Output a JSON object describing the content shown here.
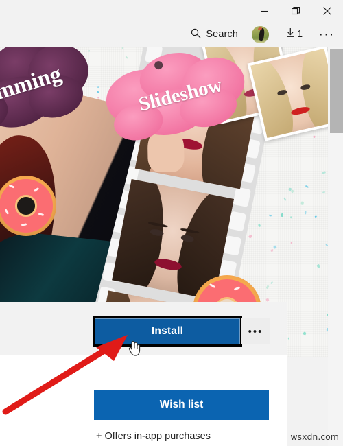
{
  "window": {
    "controls": [
      {
        "name": "minimize",
        "glyph": "minimize-icon"
      },
      {
        "name": "restore",
        "glyph": "restore-icon"
      },
      {
        "name": "close",
        "glyph": "close-icon"
      }
    ]
  },
  "commandbar": {
    "search_label": "Search",
    "search_icon": "search-icon",
    "avatar": "account-avatar",
    "downloads_icon": "downloads-arrow-icon",
    "downloads_count": "1",
    "more_label": "···"
  },
  "hero": {
    "badges": [
      {
        "text": "imming",
        "full_text": "Slimming",
        "color": "#5d2a4e"
      },
      {
        "text": "Slideshow",
        "color": "#f57fa8"
      }
    ]
  },
  "actions": {
    "install_label": "Install",
    "more_options_label": "•••",
    "wishlist_label": "Wish list",
    "iap_note": "+ Offers in-app purchases"
  },
  "overlay": {
    "cursor": "hand-pointer-cursor",
    "arrow": "red-annotation-arrow",
    "arrow_color": "#e01b18"
  },
  "scrollbar": {
    "name": "vertical-scrollbar",
    "thumb": "scroll-thumb"
  },
  "watermark": {
    "text": "wsxdn.com"
  },
  "colors": {
    "accent_install": "#0d5ca1",
    "accent_wishlist": "#0b64b1",
    "chrome": "#f2f2f2",
    "badge_pink": "#f57fa8",
    "badge_purple": "#5d2a4e"
  }
}
